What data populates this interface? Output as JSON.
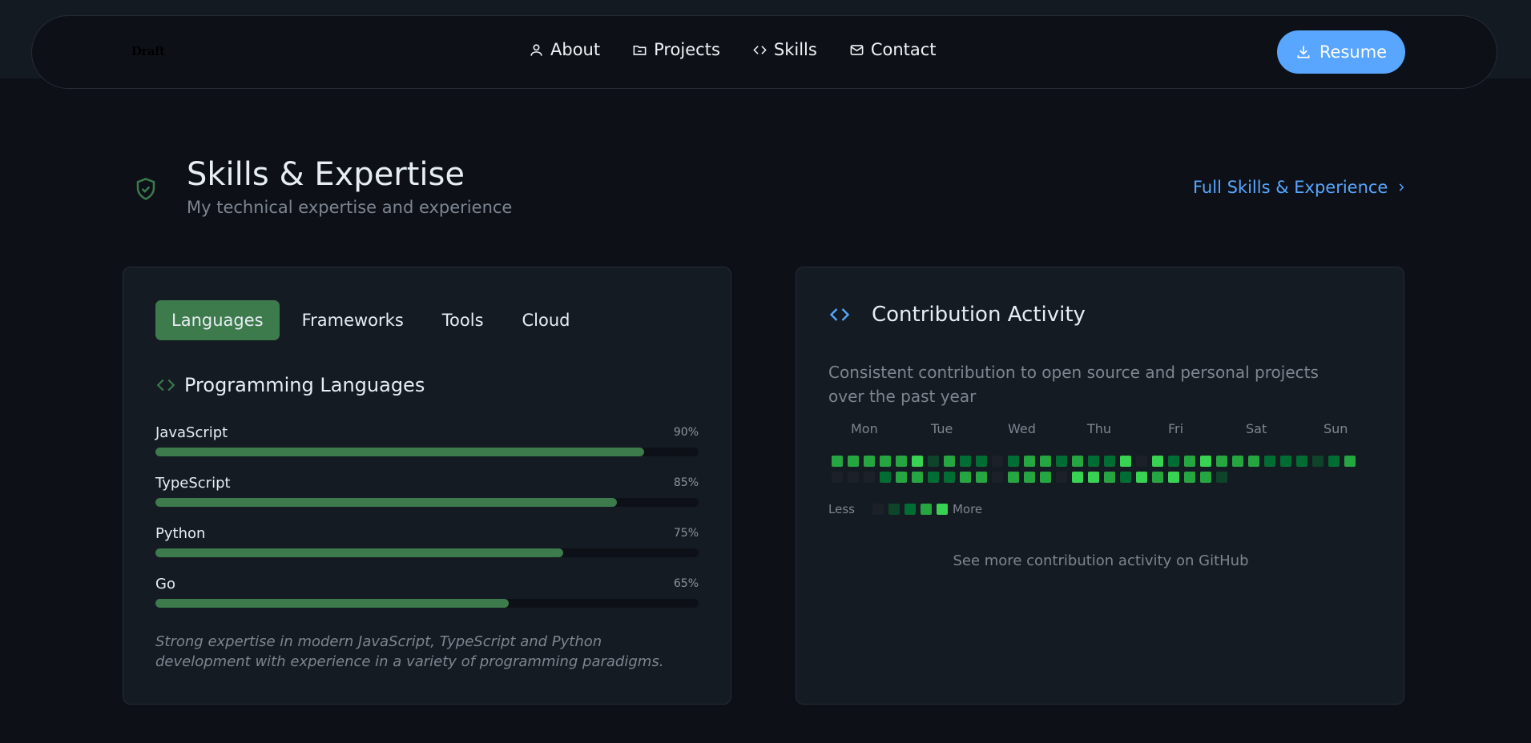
{
  "colors": {
    "accent": "#58a6ff",
    "green": "#3d7a4c",
    "bg": "#0d1117",
    "card": "#151b23"
  },
  "brand": {
    "logo_text": "Draft"
  },
  "nav": {
    "items": [
      {
        "label": "About",
        "icon": "user-icon"
      },
      {
        "label": "Projects",
        "icon": "folder-icon"
      },
      {
        "label": "Skills",
        "icon": "code-icon"
      },
      {
        "label": "Contact",
        "icon": "mail-icon"
      }
    ],
    "resume_label": "Resume"
  },
  "section": {
    "title": "Skills & Expertise",
    "subtitle": "My technical expertise and experience",
    "full_link": "Full Skills & Experience"
  },
  "skills_card": {
    "tabs": [
      "Languages",
      "Frameworks",
      "Tools",
      "Cloud"
    ],
    "active_tab": "Languages",
    "heading": "Programming Languages",
    "skills": [
      {
        "name": "JavaScript",
        "percent_label": "90%",
        "level": 90
      },
      {
        "name": "TypeScript",
        "percent_label": "85%",
        "level": 85
      },
      {
        "name": "Python",
        "percent_label": "75%",
        "level": 75
      },
      {
        "name": "Go",
        "percent_label": "65%",
        "level": 65
      }
    ],
    "note": "Strong expertise in modern JavaScript, TypeScript and Python development with experience in a variety of programming paradigms."
  },
  "activity_card": {
    "title": "Contribution Activity",
    "description": "Consistent contribution to open source and personal projects over the past year",
    "days": [
      "Mon",
      "Tue",
      "Wed",
      "Thu",
      "Fri",
      "Sat",
      "Sun"
    ],
    "legend_less": "Less",
    "legend_more": "More",
    "levels": [
      "#1c2128",
      "#0e4429",
      "#006d32",
      "#26a641",
      "#39d353"
    ],
    "rows": [
      [
        3,
        3,
        3,
        3,
        3,
        4,
        1,
        3,
        2,
        2,
        0,
        2,
        3,
        3,
        2,
        3,
        2,
        2,
        4,
        0,
        4,
        2,
        3,
        4,
        3,
        3,
        3,
        2,
        2,
        2,
        1,
        2,
        3
      ],
      [
        0,
        0,
        0,
        2,
        3,
        3,
        2,
        2,
        3,
        3,
        0,
        3,
        3,
        3,
        0,
        4,
        4,
        3,
        2,
        4,
        3,
        4,
        3,
        3,
        1
      ]
    ],
    "github_link": "See more contribution activity on GitHub"
  }
}
